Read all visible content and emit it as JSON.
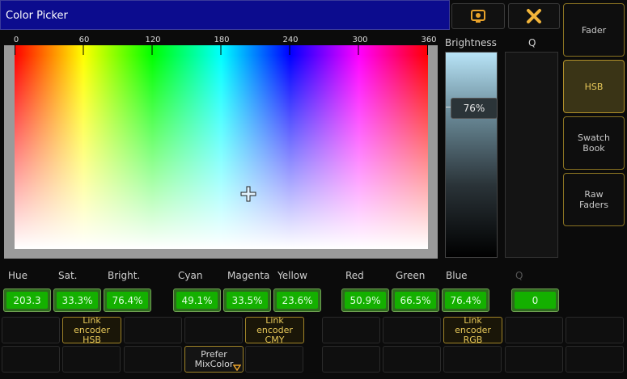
{
  "window": {
    "title": "Color Picker"
  },
  "toolbar": {
    "screen_icon": "screen-icon",
    "close_icon": "close-icon"
  },
  "sidebar": {
    "items": [
      {
        "label": "Fader",
        "active": false
      },
      {
        "label": "HSB",
        "active": true
      },
      {
        "label": "Swatch Book",
        "active": false
      },
      {
        "label": "Raw Faders",
        "active": false
      }
    ]
  },
  "spectrum": {
    "ticks": [
      "0",
      "60",
      "120",
      "180",
      "240",
      "300",
      "360"
    ],
    "crosshair_icon": "crosshair-icon"
  },
  "brightness": {
    "label": "Brightness",
    "value": "76%",
    "level": 0.76
  },
  "q": {
    "label": "Q"
  },
  "readouts": {
    "labels": {
      "hue": "Hue",
      "sat": "Sat.",
      "bright": "Bright.",
      "cyan": "Cyan",
      "magenta": "Magenta",
      "yellow": "Yellow",
      "red": "Red",
      "green": "Green",
      "blue": "Blue",
      "q": "Q"
    },
    "values": {
      "hue": "203.3",
      "sat": "33.3%",
      "bright": "76.4%",
      "cyan": "49.1%",
      "magenta": "33.5%",
      "yellow": "23.6%",
      "red": "50.9%",
      "green": "66.5%",
      "blue": "76.4%",
      "q": "0"
    }
  },
  "buttons": {
    "link_hsb": "Link encoder HSB",
    "link_cmy": "Link encoder CMY",
    "link_rgb": "Link encoder RGB",
    "prefer_mix": "Prefer MixColor"
  },
  "colors": {
    "accent": "#b08f2a",
    "title_bg": "#0c0c8e",
    "value_green": "#14b000"
  }
}
